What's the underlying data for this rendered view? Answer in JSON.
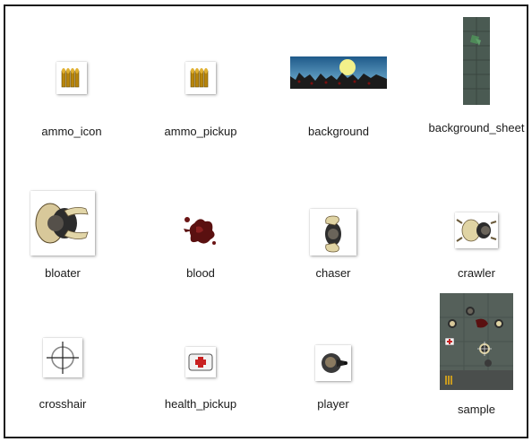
{
  "files": [
    {
      "name": "ammo_icon",
      "icon": "ammo-icon"
    },
    {
      "name": "ammo_pickup",
      "icon": "ammo-icon"
    },
    {
      "name": "background",
      "icon": "background-image"
    },
    {
      "name": "background_sheet",
      "icon": "background-sheet-image"
    },
    {
      "name": "bloater",
      "icon": "zombie-sprite"
    },
    {
      "name": "blood",
      "icon": "blood-splatter"
    },
    {
      "name": "chaser",
      "icon": "zombie-sprite"
    },
    {
      "name": "crawler",
      "icon": "zombie-sprite"
    },
    {
      "name": "crosshair",
      "icon": "crosshair-icon"
    },
    {
      "name": "health_pickup",
      "icon": "medkit-icon"
    },
    {
      "name": "player",
      "icon": "player-sprite"
    },
    {
      "name": "sample",
      "icon": "sample-image"
    }
  ]
}
